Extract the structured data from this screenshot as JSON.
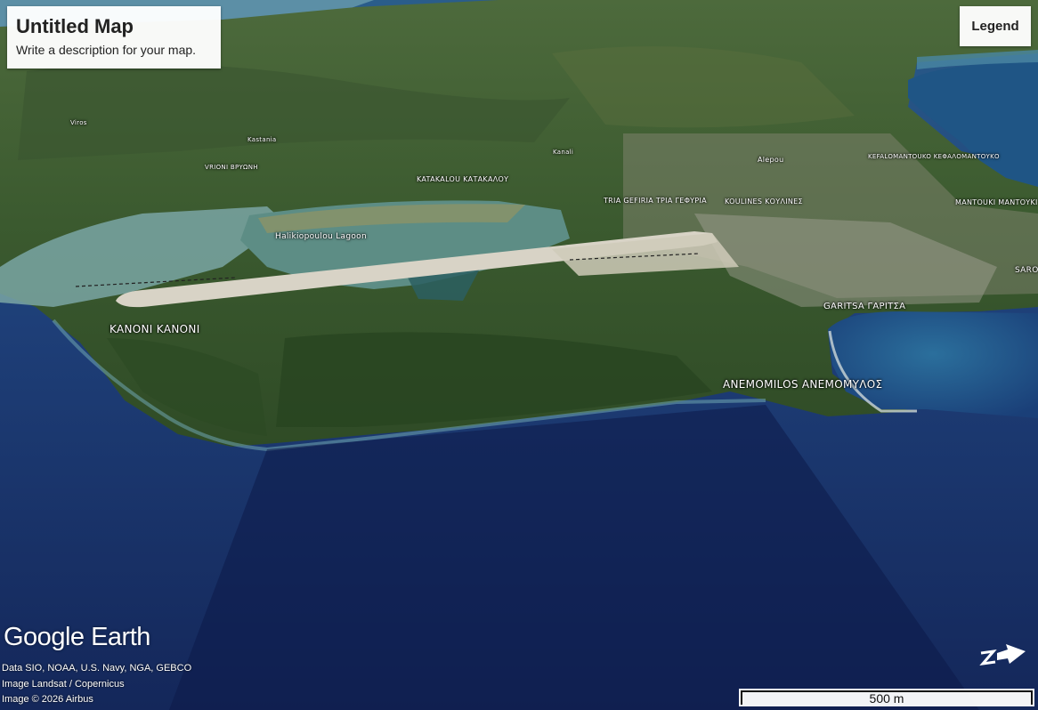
{
  "map": {
    "title": "Untitled Map",
    "description": "Write a description for your map.",
    "legend_label": "Legend"
  },
  "places": {
    "viros": "Viros",
    "kastania": "Kastania",
    "vrioni": "VRIONI ΒΡΥΩΝΗ",
    "kanali": "Kanali",
    "katakalou": "KATAKALOU ΚΑΤΑΚΑΛΟΥ",
    "alepou": "Alepou",
    "kefalomantouko": "KEFALOMANTOUKO ΚΕΦΑΛΟΜΑΝΤΟΥΚΟ",
    "tria_gefiria": "TRIA GEFIRIA ΤΡΙΑ ΓΕΦΥΡΙΑ",
    "koulines": "KOULINES ΚΟΥΛΙΝΕΣ",
    "mantouki": "MANTOUKI ΜΑΝΤΟΥΚΙ",
    "lagoon": "Halikiopoulou Lagoon",
    "saro": "SARO",
    "kanoni": "KANONI ΚΑΝΟΝΙ",
    "garitsa": "GARITSA ΓΑΡΙΤΣΑ",
    "anemomilos": "ANEMOMILOS ΑΝΕΜΟΜΥΛΟΣ"
  },
  "footer": {
    "logo": "Google Earth",
    "attribution_1": "Data SIO, NOAA, U.S. Navy, NGA, GEBCO",
    "attribution_2": "Image Landsat / Copernicus",
    "attribution_3": "Image © 2026 Airbus",
    "scale_label": "500 m"
  },
  "colors": {
    "deep_sea": "#1b2f5e",
    "land": "#3f5a2e",
    "lagoon": "#5f8e86",
    "runway": "#d8d3c6",
    "ui_panel": "#ffffff"
  },
  "icons": {
    "compass": "north-arrow-icon"
  }
}
